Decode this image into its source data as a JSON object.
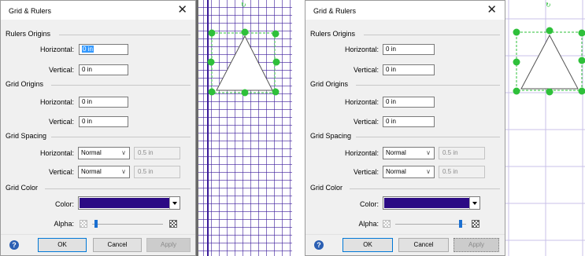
{
  "dialog": {
    "title": "Grid & Rulers",
    "close_glyph": "✕",
    "sections": {
      "rulers": "Rulers Origins",
      "grid_origins": "Grid Origins",
      "grid_spacing": "Grid Spacing",
      "grid_color": "Grid Color"
    },
    "labels": {
      "horizontal": "Horizontal:",
      "vertical": "Vertical:",
      "color": "Color:",
      "alpha": "Alpha:"
    },
    "buttons": {
      "ok": "OK",
      "cancel": "Cancel",
      "apply": "Apply",
      "help": "?"
    },
    "dropdown_arrow": "∨"
  },
  "left": {
    "rulers_horizontal": "0 in",
    "rulers_vertical": "0 in",
    "grid_horizontal": "0 in",
    "grid_vertical": "0 in",
    "spacing_horizontal_select": "Normal",
    "spacing_horizontal_value": "0.5 in",
    "spacing_vertical_select": "Normal",
    "spacing_vertical_value": "0.5 in",
    "grid_color": "#2b0a84",
    "alpha_fraction": 0.05
  },
  "right": {
    "rulers_horizontal": "0 in",
    "rulers_vertical": "0 in",
    "grid_horizontal": "0 in",
    "grid_vertical": "0 in",
    "spacing_horizontal_select": "Normal",
    "spacing_horizontal_value": "0.5 in",
    "spacing_vertical_select": "Normal",
    "spacing_vertical_value": "0.5 in",
    "grid_color": "#2b0a84",
    "alpha_fraction": 0.92
  },
  "colors": {
    "handle": "#2ec03a",
    "grid_light": "#c9c0e8",
    "grid_dark": "#3a1a9a",
    "selection": "#3399ff",
    "help_icon": "#2b5fb3"
  }
}
